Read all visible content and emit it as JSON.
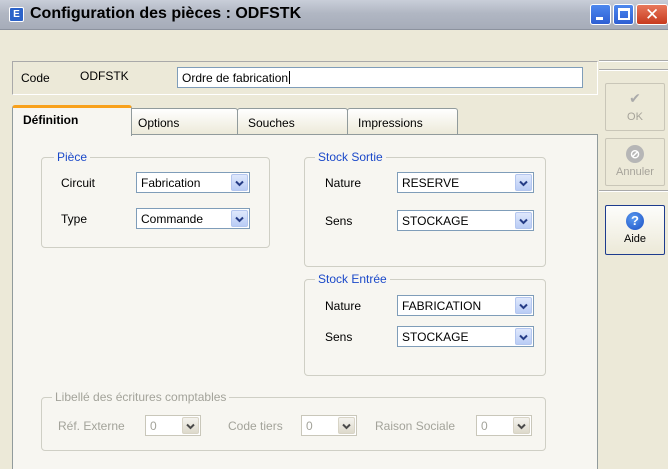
{
  "window": {
    "title": "Configuration des pièces : ODFSTK",
    "app_icon": "window-app-icon"
  },
  "header": {
    "code_label": "Code",
    "code_value": "ODFSTK",
    "description_value": "Ordre de fabrication"
  },
  "tabs": [
    {
      "label": "Définition",
      "active": true
    },
    {
      "label": "Options",
      "active": false
    },
    {
      "label": "Souches",
      "active": false
    },
    {
      "label": "Impressions",
      "active": false
    }
  ],
  "piece": {
    "title": "Pièce",
    "circuit_label": "Circuit",
    "circuit_value": "Fabrication",
    "type_label": "Type",
    "type_value": "Commande"
  },
  "stock_sortie": {
    "title": "Stock Sortie",
    "nature_label": "Nature",
    "nature_value": "RESERVE",
    "sens_label": "Sens",
    "sens_value": "STOCKAGE"
  },
  "stock_entree": {
    "title": "Stock Entrée",
    "nature_label": "Nature",
    "nature_value": "FABRICATION",
    "sens_label": "Sens",
    "sens_value": "STOCKAGE"
  },
  "libelle": {
    "title": "Libellé des écritures comptables",
    "ref_label": "Réf. Externe",
    "ref_value": "0",
    "code_tiers_label": "Code tiers",
    "code_tiers_value": "0",
    "raison_label": "Raison Sociale",
    "raison_value": "0",
    "enabled": false
  },
  "side_buttons": {
    "ok_label": "OK",
    "cancel_label": "Annuler",
    "help_label": "Aide",
    "ok_glyph": "✔",
    "cancel_glyph": "⊘",
    "help_glyph": "?"
  },
  "colors": {
    "group_title": "#1b49c9",
    "active_tab_accent": "#f8a11b",
    "disabled_text": "#a3a39a"
  }
}
